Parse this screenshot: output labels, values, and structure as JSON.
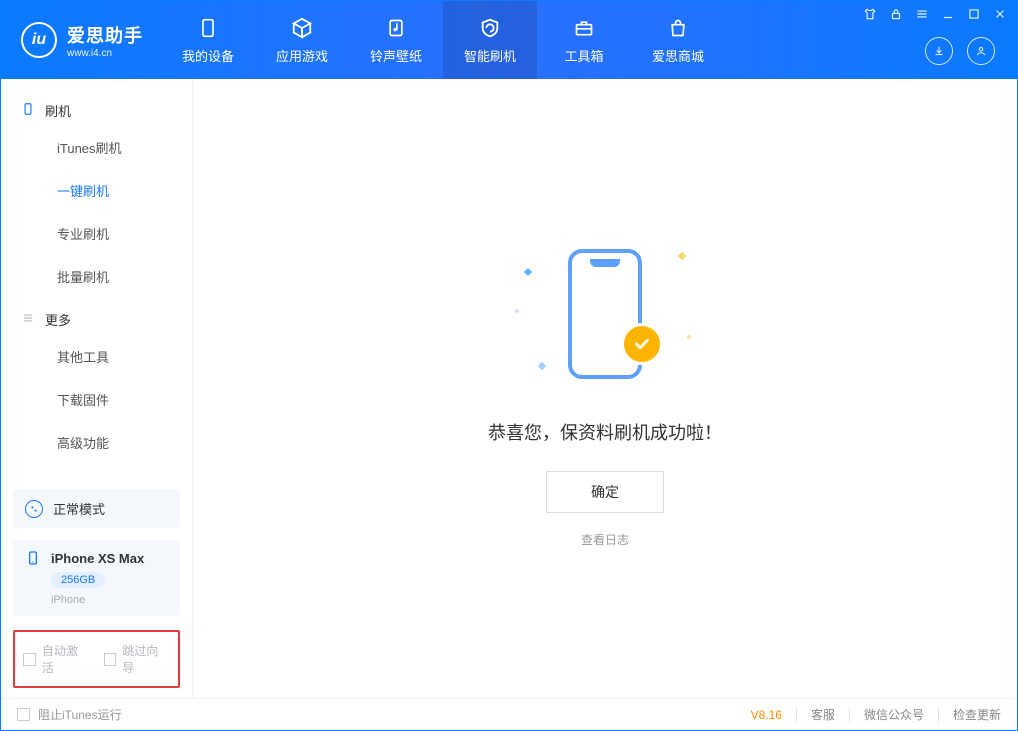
{
  "app": {
    "brand": "爱思助手",
    "url": "www.i4.cn"
  },
  "header": {
    "tabs": [
      {
        "label": "我的设备"
      },
      {
        "label": "应用游戏"
      },
      {
        "label": "铃声壁纸"
      },
      {
        "label": "智能刷机"
      },
      {
        "label": "工具箱"
      },
      {
        "label": "爱思商城"
      }
    ]
  },
  "sidebar": {
    "section_flash": "刷机",
    "flash_items": [
      {
        "label": "iTunes刷机"
      },
      {
        "label": "一键刷机"
      },
      {
        "label": "专业刷机"
      },
      {
        "label": "批量刷机"
      }
    ],
    "section_more": "更多",
    "more_items": [
      {
        "label": "其他工具"
      },
      {
        "label": "下载固件"
      },
      {
        "label": "高级功能"
      }
    ],
    "mode_label": "正常模式",
    "device": {
      "name": "iPhone XS Max",
      "storage": "256GB",
      "type": "iPhone"
    },
    "option_auto_activate": "自动激活",
    "option_skip_guide": "跳过向导"
  },
  "main": {
    "success_text": "恭喜您，保资料刷机成功啦！",
    "ok_button": "确定",
    "view_log": "查看日志"
  },
  "statusbar": {
    "block_itunes": "阻止iTunes运行",
    "version": "V8.16",
    "support": "客服",
    "wechat": "微信公众号",
    "check_update": "检查更新"
  }
}
